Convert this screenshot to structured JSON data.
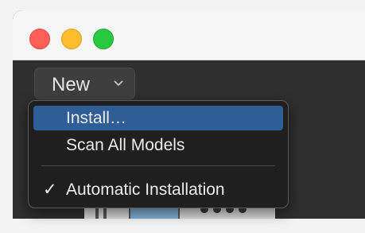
{
  "window": {
    "traffic_lights": {
      "close_color": "#ff5f57",
      "minimize_color": "#febc2e",
      "zoom_color": "#28c840"
    }
  },
  "toolbar": {
    "new_label": "New",
    "new_icon": "chevron-down-icon"
  },
  "menu": {
    "items": [
      {
        "label": "Install…",
        "highlighted": true,
        "checked": false
      },
      {
        "label": "Scan All Models",
        "highlighted": false,
        "checked": false
      },
      {
        "label": "Automatic Installation",
        "highlighted": false,
        "checked": true
      }
    ],
    "check_glyph": "✓",
    "highlight_color": "#2f5e96"
  }
}
